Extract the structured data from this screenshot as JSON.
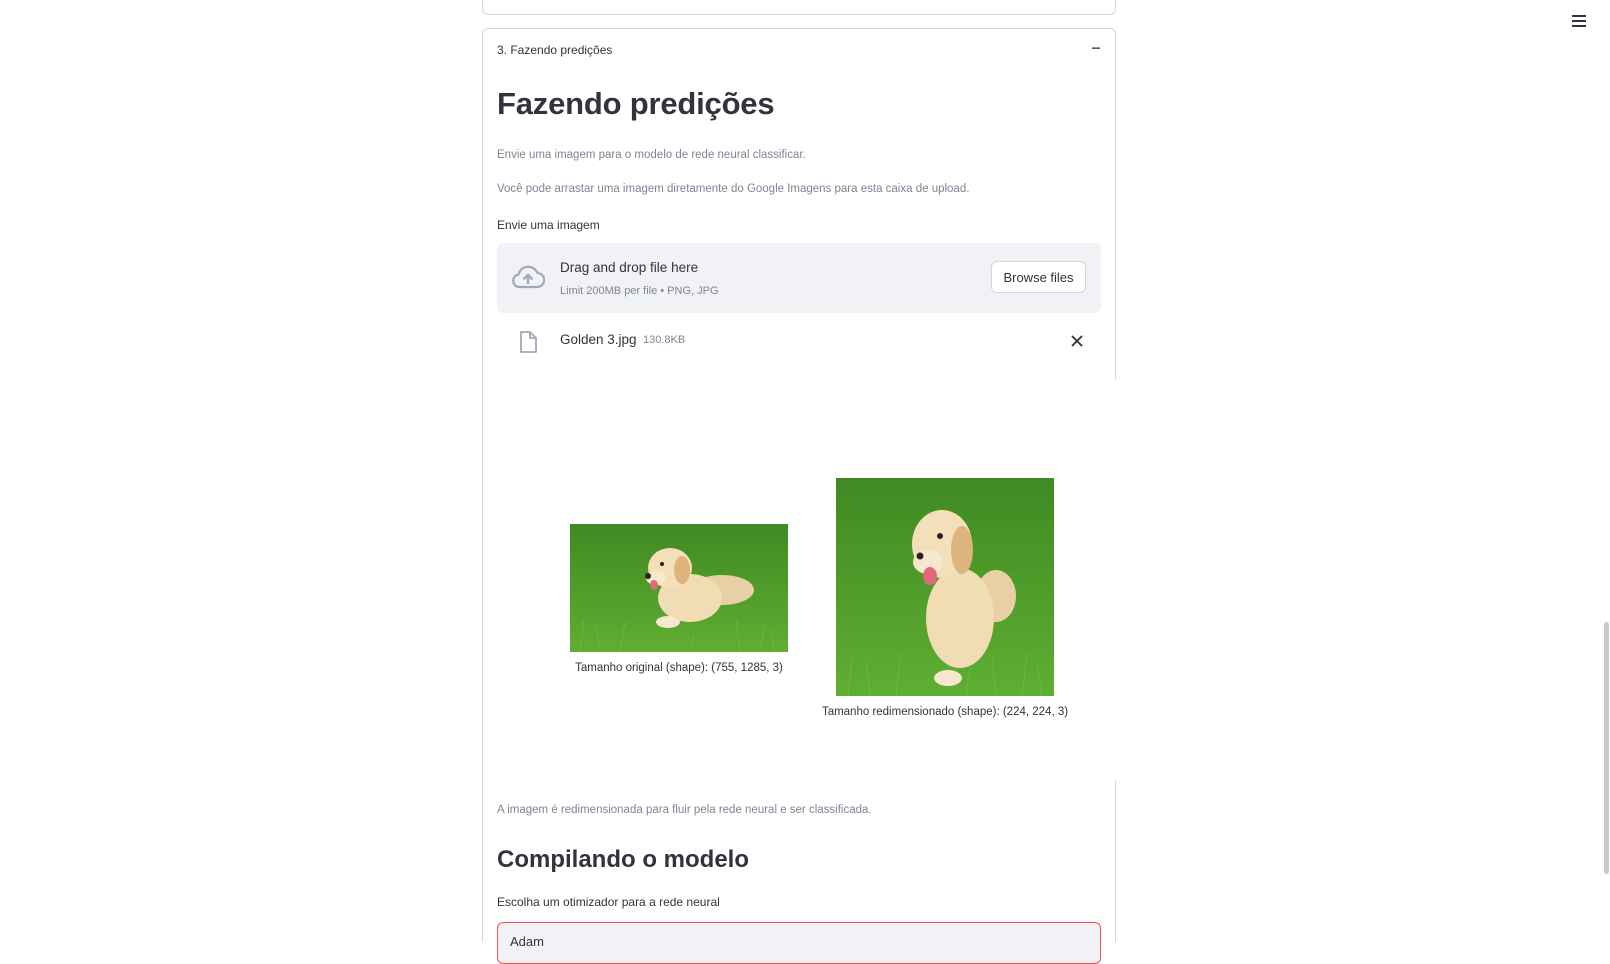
{
  "expander": {
    "header_label": "3. Fazendo predições"
  },
  "content": {
    "title": "Fazendo predições",
    "caption_1": "Envie uma imagem para o modelo de rede neural classificar.",
    "caption_2": "Você pode arrastar uma imagem diretamente do Google Imagens para esta caixa de upload.",
    "upload_label": "Envie uma imagem"
  },
  "uploader": {
    "drag_text": "Drag and drop file here",
    "limit_text": "Limit 200MB per file • PNG, JPG",
    "browse_label": "Browse files"
  },
  "file": {
    "name": "Golden 3.jpg",
    "size": "130.8KB"
  },
  "images": {
    "original_caption": "Tamanho original (shape): (755, 1285, 3)",
    "resized_caption": "Tamanho redimensionado (shape): (224, 224, 3)"
  },
  "after": {
    "caption": "A imagem é redimensionada para fluir pela rede neural e ser classificada.",
    "section_title": "Compilando o modelo",
    "optimizer_label": "Escolha um otimizador para a rede neural",
    "optimizer_value": "Adam"
  },
  "colors": {
    "text": "#31333f",
    "muted": "#808495",
    "uploader_bg": "#f0f2f6",
    "accent": "#ff4b4b",
    "grass": "#4f9a2a"
  }
}
